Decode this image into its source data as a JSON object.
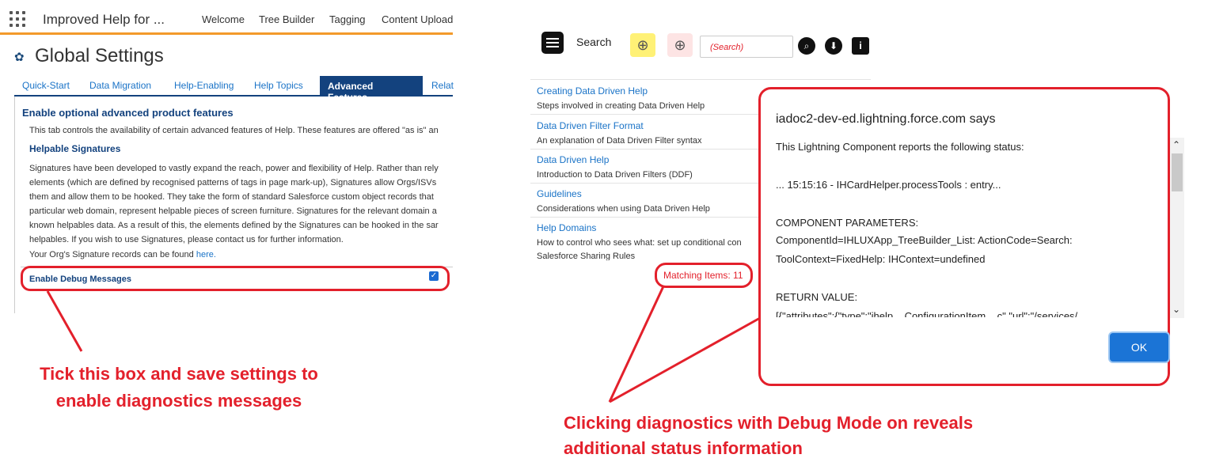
{
  "left": {
    "app_title": "Improved Help for ...",
    "nav": [
      "Welcome",
      "Tree Builder",
      "Tagging",
      "Content Upload"
    ],
    "page_title": "Global Settings",
    "tabs": [
      "Quick-Start",
      "Data Migration",
      "Help-Enabling",
      "Help Topics",
      "Advanced Features",
      "Relat"
    ],
    "section_title": "Enable optional advanced product features",
    "intro": "This tab controls the availability of certain advanced features of Help. These features are offered \"as is\" an",
    "sig_title": "Helpable Signatures",
    "sig_lines": [
      "Signatures have been developed to vastly expand the reach, power and flexibility of Help. Rather than rely",
      "elements (which are defined by recognised patterns of tags in page mark-up), Signatures allow Orgs/ISVs",
      "them and allow them to be hooked. They take the form of standard Salesforce custom object records that",
      "particular web domain, represent helpable pieces of screen furniture. Signatures for the relevant domain a",
      "known helpables data. As a result of this, the elements defined by the Signatures can be hooked in the sar",
      "helpables. If you wish to use Signatures, please contact us for further information."
    ],
    "sig_records": "Your Org's Signature records can be found",
    "here_link": "here.",
    "debug_label": "Enable Debug Messages",
    "debug_checked": true
  },
  "right": {
    "search_label": "Search",
    "search_placeholder": "(Search)",
    "items": [
      {
        "title": "Creating Data Driven Help",
        "desc": "Steps involved in creating Data Driven Help"
      },
      {
        "title": "Data Driven Filter Format",
        "desc": "An explanation of Data Driven Filter syntax"
      },
      {
        "title": "Data Driven Help",
        "desc": "Introduction to Data Driven Filters (DDF)"
      },
      {
        "title": "Guidelines",
        "desc": "Considerations when using Data Driven Help"
      },
      {
        "title": "Help Domains",
        "desc": "How to control who sees what: set up conditional con"
      }
    ],
    "last_desc": "Salesforce Sharing Rules",
    "matching": "Matching Items: 11"
  },
  "dialog": {
    "title": "iadoc2-dev-ed.lightning.force.com says",
    "lines": [
      "This Lightning Component reports the following status:",
      "... 15:15:16 - IHCardHelper.processTools : entry...",
      "COMPONENT PARAMETERS:",
      "ComponentId=IHLUXApp_TreeBuilder_List: ActionCode=Search:",
      "ToolContext=FixedHelp: IHContext=undefined",
      "RETURN VALUE:",
      "[{\"attributes\":{\"type\":\"ihelp__ConfigurationItem__c\",\"url\":\"/services/"
    ],
    "ok_label": "OK"
  },
  "annotations": {
    "left_callout": [
      "Tick this box and save settings to",
      "enable diagnostics messages"
    ],
    "right_callout": [
      "Clicking diagnostics with Debug Mode on reveals",
      "additional status information"
    ]
  },
  "colors": {
    "accent_red": "#e3202b",
    "brand_blue": "#13427e",
    "link_blue": "#1a73c7",
    "top_orange": "#f39a2b"
  }
}
